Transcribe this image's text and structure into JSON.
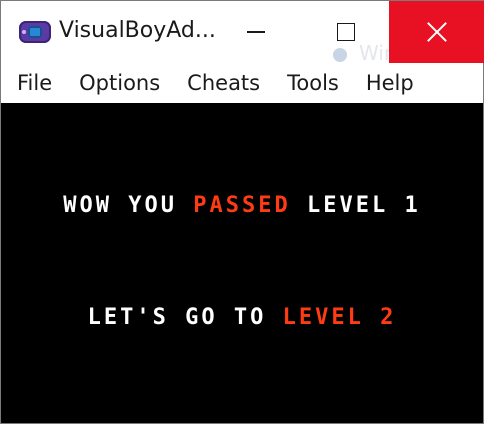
{
  "window": {
    "title": "VisualBoyAd...",
    "background_title_fragment": "Window S",
    "controls": {
      "minimize_icon": "minimize-icon",
      "maximize_icon": "maximize-icon",
      "close_icon": "close-icon",
      "close_color": "#e81123"
    }
  },
  "menu": {
    "items": [
      "File",
      "Options",
      "Cheats",
      "Tools",
      "Help"
    ]
  },
  "game": {
    "background": "#000000",
    "highlight_color": "#ff3b14",
    "line1": {
      "before": "WOW YOU ",
      "highlight": "PASSED",
      "after": " LEVEL 1"
    },
    "line2": {
      "before": "LET'S GO TO ",
      "highlight": "LEVEL 2",
      "after": ""
    }
  }
}
